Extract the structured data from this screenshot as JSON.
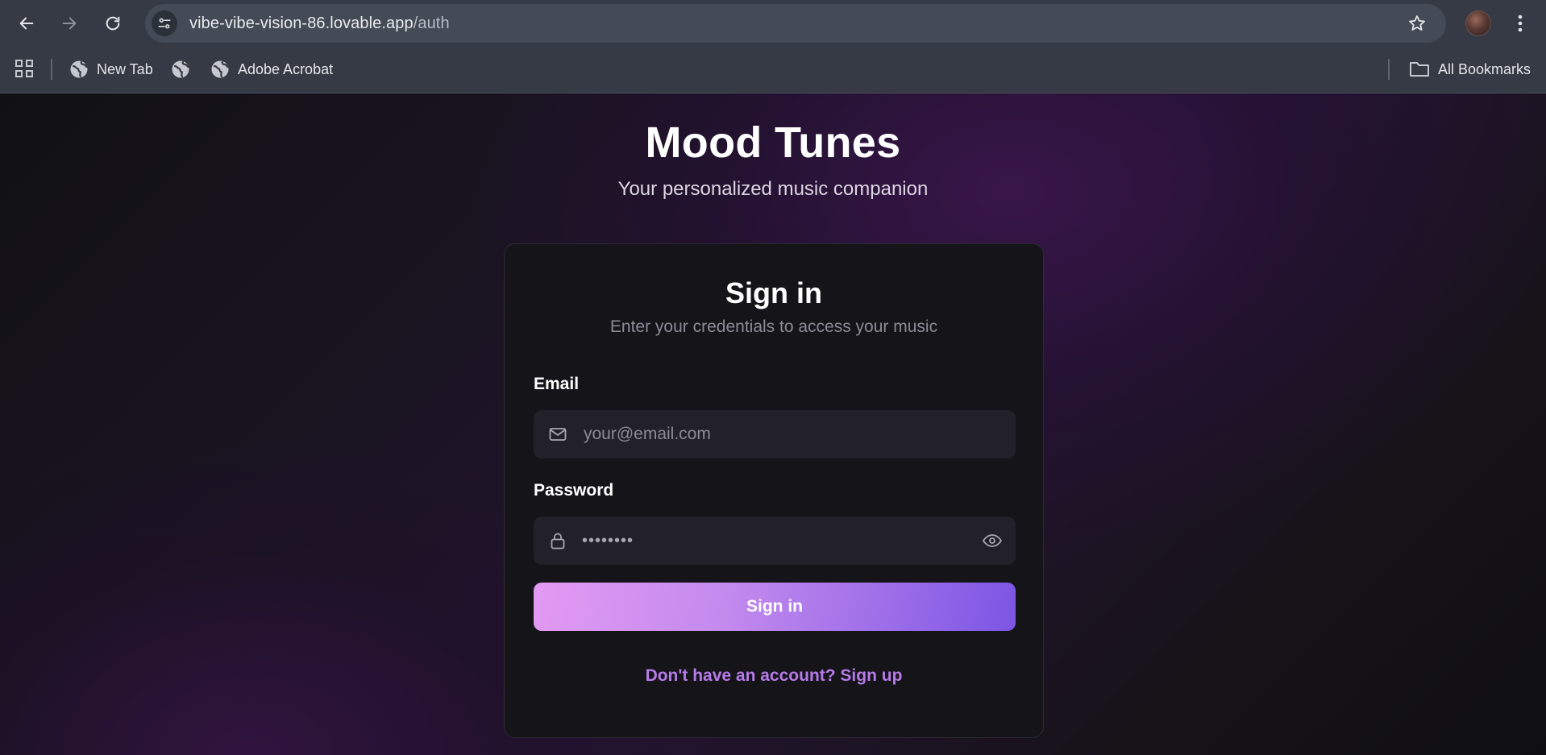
{
  "browser": {
    "url_host": "vibe-vibe-vision-86.lovable.app",
    "url_path": "/auth",
    "bookmarks": [
      {
        "label": "New Tab",
        "icon": "globe-icon"
      },
      {
        "label": "",
        "icon": "globe-icon"
      },
      {
        "label": "Adobe Acrobat",
        "icon": "globe-icon"
      }
    ],
    "all_bookmarks_label": "All Bookmarks"
  },
  "hero": {
    "title": "Mood Tunes",
    "subtitle": "Your personalized music companion"
  },
  "card": {
    "title": "Sign in",
    "subtitle": "Enter your credentials to access your music",
    "email": {
      "label": "Email",
      "placeholder": "your@email.com",
      "icon": "mail-icon"
    },
    "password": {
      "label": "Password",
      "value_mask": "••••••••",
      "icon": "lock-icon",
      "toggle_icon": "eye-icon"
    },
    "submit_label": "Sign in",
    "signup_text": "Don't have an account? Sign up"
  },
  "colors": {
    "accent_start": "#e39af3",
    "accent_end": "#7c55e4",
    "link": "#b67be8",
    "card_bg": "#141419",
    "input_bg": "#22212a"
  }
}
